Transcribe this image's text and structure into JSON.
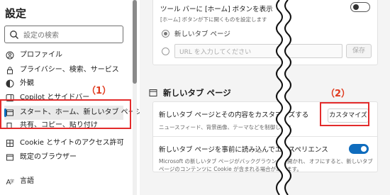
{
  "sidebar": {
    "title": "設定",
    "search_placeholder": "設定の検索",
    "items": [
      {
        "label": "プロファイル",
        "icon": "profile-icon"
      },
      {
        "label": "プライバシー、検索、サービス",
        "icon": "lock-icon"
      },
      {
        "label": "外観",
        "icon": "appearance-icon"
      },
      {
        "label": "Copilot とサイドバー",
        "icon": "copilot-icon"
      },
      {
        "label": "スタート、ホーム、新しいタブ ページ",
        "icon": "home-tab-icon"
      },
      {
        "label": "共有、コピー、貼り付け",
        "icon": "share-icon"
      },
      {
        "label": "Cookie とサイトのアクセス許可",
        "icon": "cookie-icon"
      },
      {
        "label": "既定のブラウザー",
        "icon": "browser-icon"
      },
      {
        "label": "言語",
        "icon": "language-icon"
      }
    ]
  },
  "annotations": {
    "label1": "（1）",
    "label2": "（2）",
    "color": "#e32b2b"
  },
  "main": {
    "home_button": {
      "title": "ツール バーに [ホーム] ボタンを表示",
      "desc": "[ホーム] ボタンが下に開くものを設定します",
      "option_newtab": "新しいタブ ページ",
      "url_placeholder": "URL を入力してください",
      "save_label": "保存",
      "enabled": false
    },
    "newtab_section": {
      "heading": "新しいタブ ページ",
      "heading_icon": "newtab-icon",
      "customize_title": "新しいタブ ページとその内容をカスタマイズする",
      "customize_desc": "ニュースフィード、背景画像、テーマなどを制御します",
      "customize_button": "カスタマイズ",
      "preload_title": "新しいタブ ページを事前に読み込んでエクスペリエンス",
      "preload_desc_1": "Microsoft の新しいタブ ページがバックグラウンドで開かれ、",
      "preload_desc_1b": "オフにすると、新しいタブ",
      "preload_desc_2": "ページのコンテンツに Cookie が含まれる場合があります。",
      "preload_enabled": true
    }
  }
}
